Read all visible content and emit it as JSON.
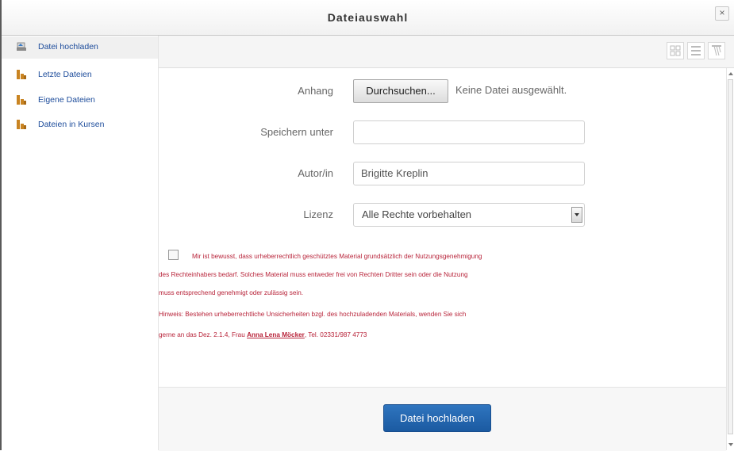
{
  "dialog": {
    "title": "Dateiauswahl",
    "close": "×"
  },
  "sidebar": {
    "items": [
      {
        "label": "Datei hochladen",
        "icon": "upload-icon"
      },
      {
        "label": "Letzte Dateien",
        "icon": "repository-icon"
      },
      {
        "label": "Eigene Dateien",
        "icon": "repository-icon"
      },
      {
        "label": "Dateien in Kursen",
        "icon": "repository-icon"
      }
    ]
  },
  "toolbar": {
    "icons": [
      "grid-view-icon",
      "list-view-icon",
      "tree-view-icon"
    ]
  },
  "form": {
    "attachment_label": "Anhang",
    "browse_label": "Durchsuchen...",
    "no_file_text": "Keine Datei ausgewählt.",
    "save_as_label": "Speichern unter",
    "save_as_value": "",
    "author_label": "Autor/in",
    "author_value": "Brigitte Kreplin",
    "license_label": "Lizenz",
    "license_value": "Alle Rechte vorbehalten"
  },
  "notice": {
    "line1": "Mir ist bewusst, dass urheberrechtlich geschütztes Material grundsätzlich der Nutzungsgenehmigung",
    "line2": "des Rechteinhabers bedarf. Solches Material muss entweder frei von Rechten Dritter sein oder die Nutzung",
    "line3": "muss entsprechend genehmigt oder zulässig sein.",
    "line4": "Hinweis: Bestehen urheberrechtliche Unsicherheiten bzgl. des hochzuladenden Materials, wenden Sie sich",
    "line5_prefix": "gerne an das Dez. 2.1.4, Frau ",
    "line5_link": "Anna Lena Möcker",
    "line5_suffix": ", Tel. 02331/987 4773"
  },
  "footer": {
    "upload_label": "Datei hochladen"
  },
  "colors": {
    "accent": "#1f5ea8",
    "notice": "#b8243a",
    "link": "#1d4c9b"
  }
}
